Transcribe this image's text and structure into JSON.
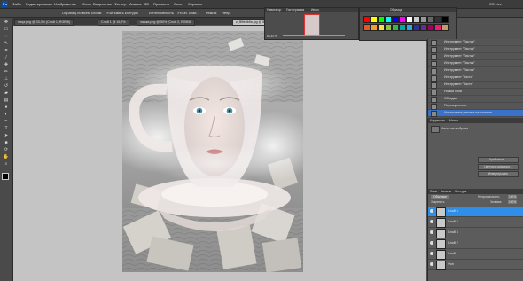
{
  "menu": {
    "app_icon": "Ps",
    "items": [
      "Файл",
      "Редактирование",
      "Изображение",
      "Слои",
      "Выделение",
      "Фильтр",
      "Анализ",
      "3D",
      "Просмотр",
      "Окно",
      "Справка"
    ],
    "right": "CS Live"
  },
  "options": {
    "items": [
      "Образец по всем слоям",
      "Учитывать контуры",
      "Интенсивность",
      "Уточн. край...",
      "Режим",
      "Непр."
    ]
  },
  "tabs": [
    {
      "label": "лица.png @ 33,3% (Слой 1, RGB/8)"
    },
    {
      "label": "Слой 1 @ 16,7%"
    },
    {
      "label": "чашка.png @ 50% (Слой 2, RGB/8)"
    },
    {
      "label": "z_f89e8b5a.jpg @ 66,7% (Слой 3...)"
    }
  ],
  "navigator": {
    "tabs": [
      "Навигатор",
      "Гистограмма",
      "Инфо"
    ],
    "zoom": "66,67%"
  },
  "swatches": {
    "title": "Образцы",
    "colors": [
      "#ff0000",
      "#ffff00",
      "#00ff00",
      "#00ffff",
      "#0000ff",
      "#ff00ff",
      "#ffffff",
      "#cccccc",
      "#999999",
      "#666666",
      "#333333",
      "#000000",
      "#e05a2a",
      "#f0a030",
      "#f6e040",
      "#8cc63f",
      "#39b54a",
      "#00a99d",
      "#29abe2",
      "#2e3192",
      "#662d91",
      "#9e005d",
      "#ed1e79",
      "#c69c6d"
    ]
  },
  "history": {
    "items": [
      {
        "label": "Инструмент \"Ластик\""
      },
      {
        "label": "Инструмент \"Ластик\""
      },
      {
        "label": "Инструмент \"Ластик\""
      },
      {
        "label": "Инструмент \"Ластик\""
      },
      {
        "label": "Инструмент \"Ластик\""
      },
      {
        "label": "Инструмент \"Кисть\""
      },
      {
        "label": "Инструмент \"Кисть\""
      },
      {
        "label": "Новый слой"
      },
      {
        "label": "Обводка"
      },
      {
        "label": "Перевод слоев"
      },
      {
        "label": "Исключение режима наложения"
      }
    ],
    "selected_index": 10
  },
  "adjust": {
    "tabs": [
      "Коррекция",
      "Маски"
    ],
    "mask_label": "Маска не выбрана",
    "buttons": [
      "Край маски...",
      "Цветовой диапазон...",
      "Инвертировать"
    ]
  },
  "layers": {
    "tabs": [
      "Слои",
      "Каналы",
      "Контуры"
    ],
    "blend": "Обычные",
    "opacity_label": "Непрозрачность:",
    "opacity": "100%",
    "fill_label": "Заливка:",
    "fill": "100%",
    "lock_label": "Закрепить:",
    "items": [
      {
        "name": "Слой 5"
      },
      {
        "name": "Слой 4"
      },
      {
        "name": "Слой 3"
      },
      {
        "name": "Слой 2"
      },
      {
        "name": "Слой 1"
      },
      {
        "name": "Фон"
      }
    ],
    "selected_index": 0
  }
}
